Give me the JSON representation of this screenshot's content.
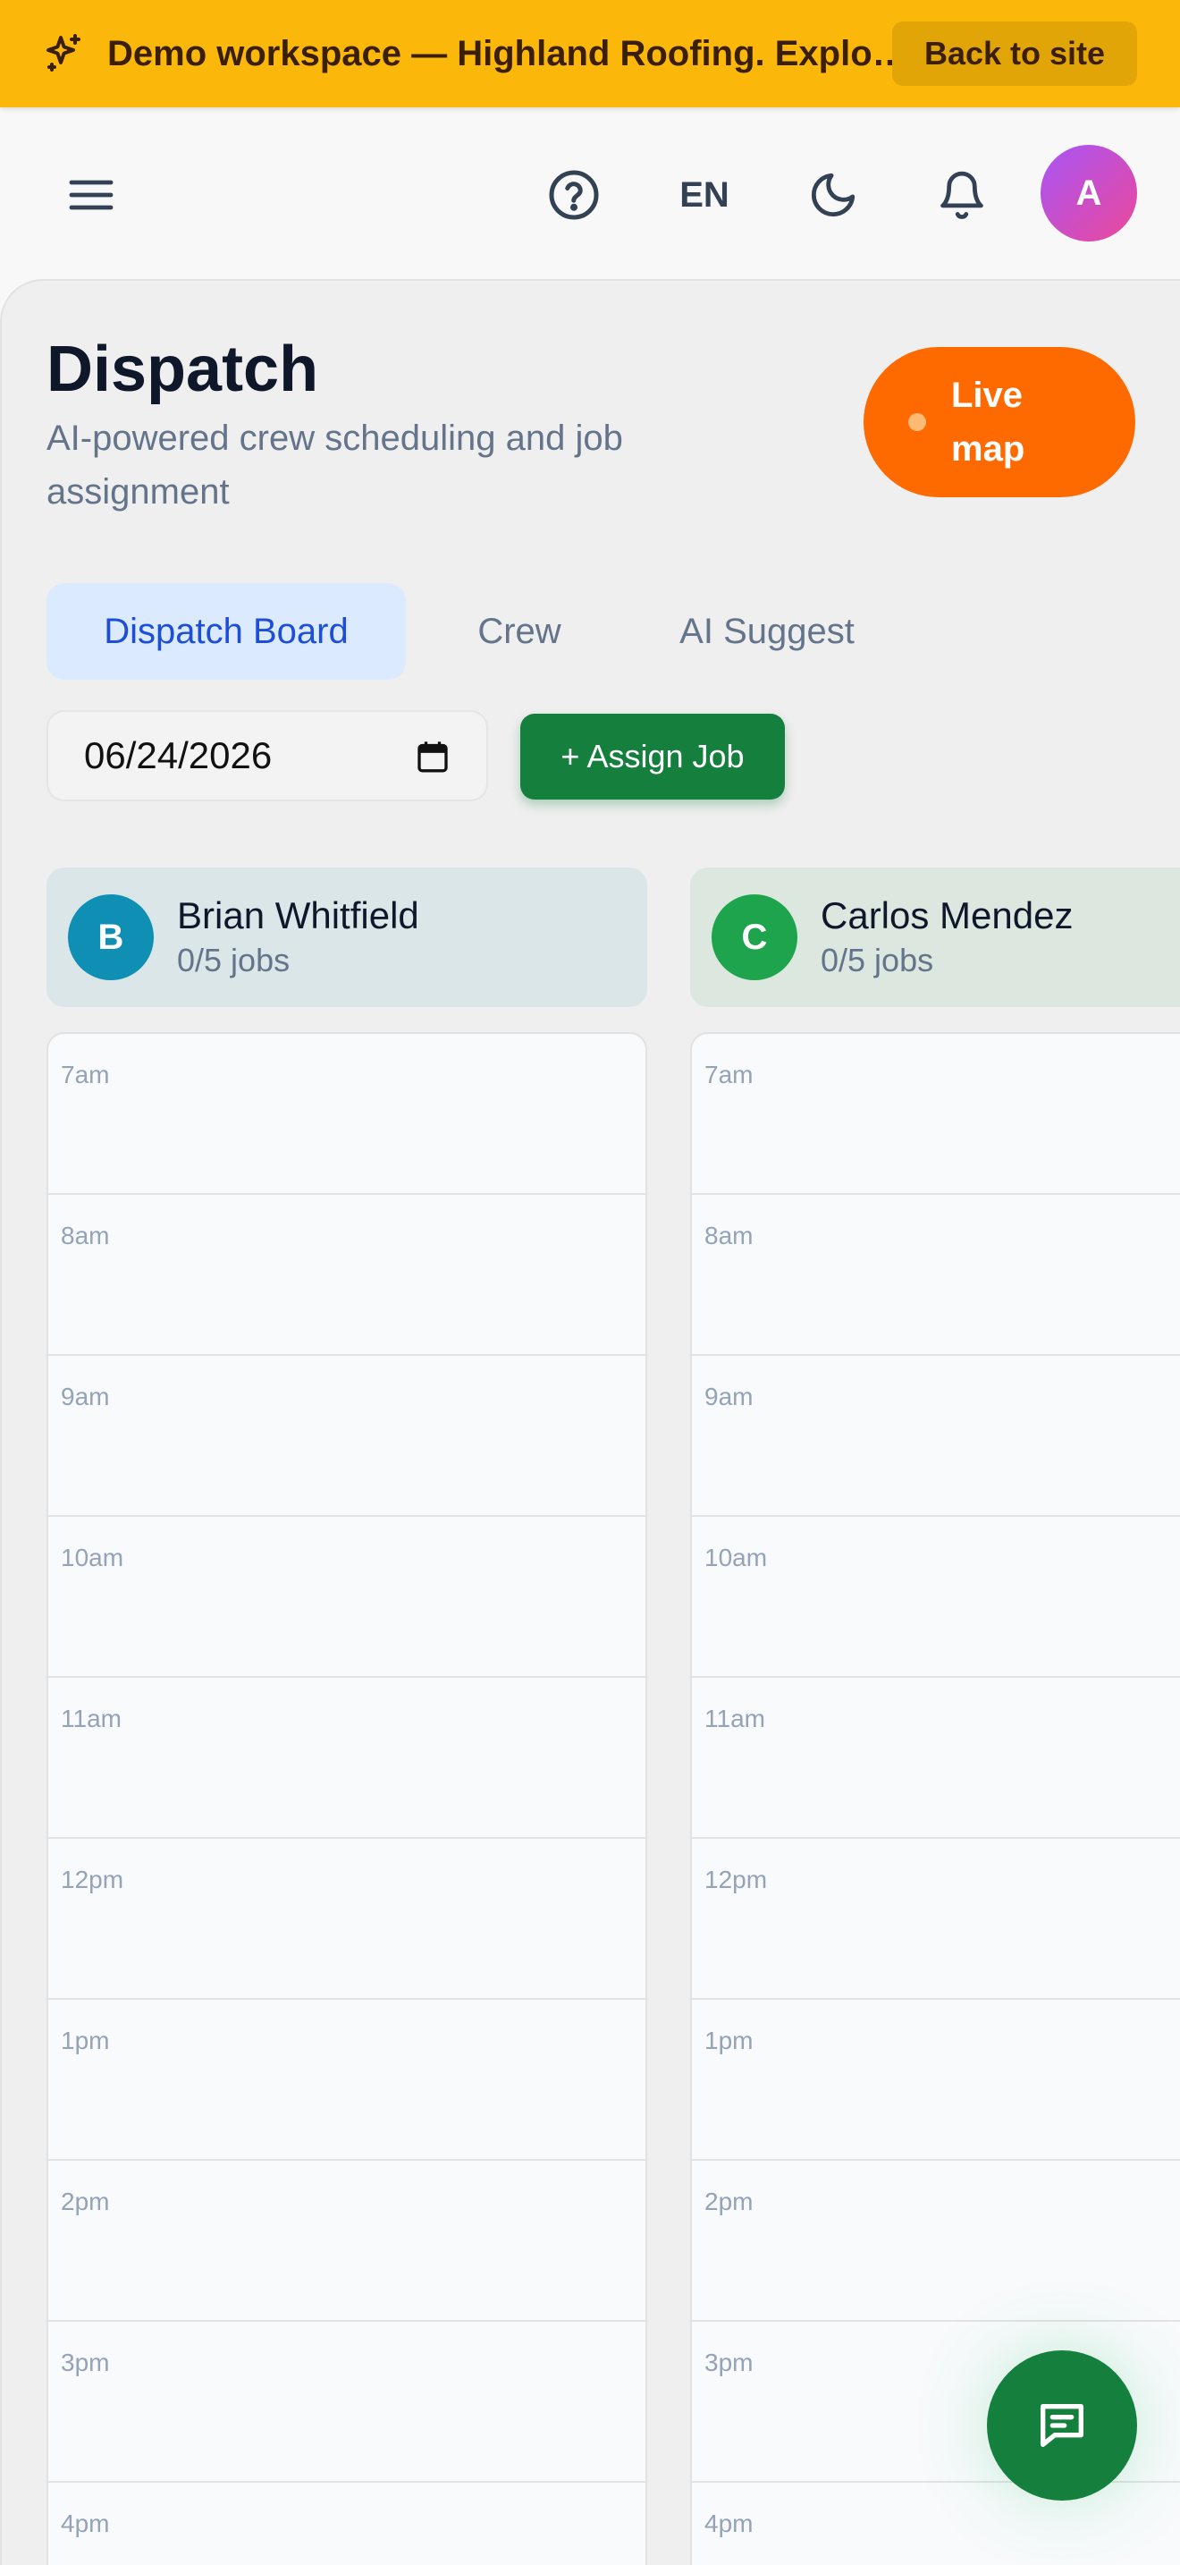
{
  "banner": {
    "text": "Demo workspace — Highland Roofing. Explore freely, changes are not saved.",
    "back_label": "Back to site",
    "icon": "sparkles-icon"
  },
  "topbar": {
    "menu_icon": "hamburger-menu-icon",
    "help_icon": "help-circle-icon",
    "language": "EN",
    "theme_icon": "moon-icon",
    "notification_icon": "bell-icon",
    "avatar_initial": "A"
  },
  "page": {
    "title": "Dispatch",
    "subtitle": "AI-powered crew scheduling and job assignment",
    "live_map_label": "Live map"
  },
  "tabs": [
    {
      "label": "Dispatch Board",
      "active": true
    },
    {
      "label": "Crew",
      "active": false
    },
    {
      "label": "AI Suggest",
      "active": false
    }
  ],
  "controls": {
    "date_value": "06/24/2026",
    "assign_label": "+ Assign Job"
  },
  "crew": [
    {
      "initial": "B",
      "name": "Brian Whitfield",
      "jobs": "0/5 jobs",
      "avatar_color": "#0e8fb3",
      "header_bg": "#dbe6e9"
    },
    {
      "initial": "C",
      "name": "Carlos Mendez",
      "jobs": "0/5 jobs",
      "avatar_color": "#1ea44c",
      "header_bg": "#dce7df"
    }
  ],
  "time_slots": [
    "7am",
    "8am",
    "9am",
    "10am",
    "11am",
    "12pm",
    "1pm",
    "2pm",
    "3pm",
    "4pm"
  ],
  "colors": {
    "banner": "#fbb80a",
    "accent_orange": "#ff6a00",
    "primary_green": "#15803d",
    "active_tab": "#dbeafe"
  },
  "fab_icon": "chat-message-icon"
}
